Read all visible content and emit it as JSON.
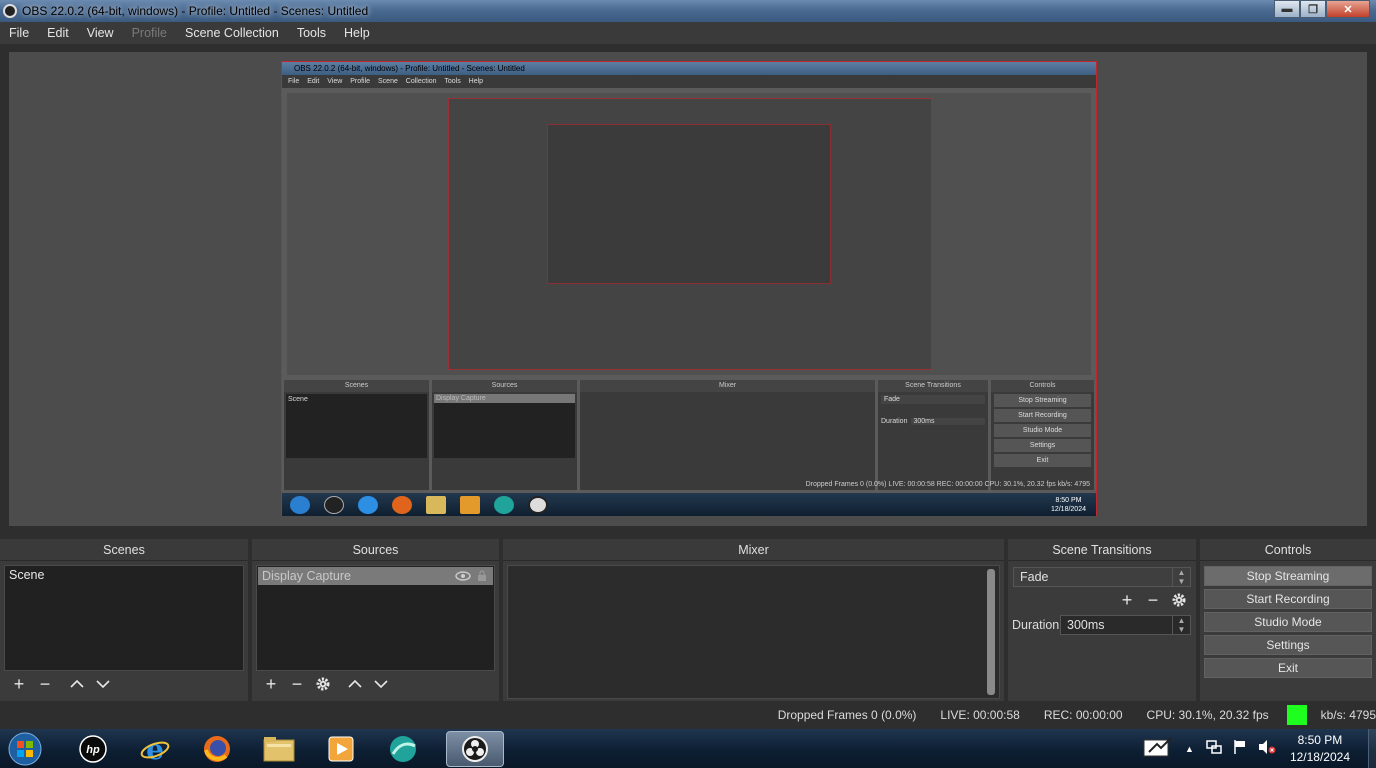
{
  "window": {
    "title": "OBS 22.0.2 (64-bit, windows) - Profile: Untitled - Scenes: Untitled",
    "minimize": "▬",
    "restore": "❐",
    "close": "✕"
  },
  "menu": [
    "File",
    "Edit",
    "View",
    "Profile",
    "Scene Collection",
    "Tools",
    "Help"
  ],
  "nested": {
    "title": "OBS 22.0.2 (64-bit, windows) - Profile: Untitled - Scenes: Untitled",
    "menu": "File Edit View Profile Scene Collection Tools Help",
    "docks": [
      "Scenes",
      "Sources",
      "Mixer",
      "Scene Transitions",
      "Controls"
    ],
    "scene": "Scene",
    "source": "Display Capture",
    "transition": "Fade",
    "duration_label": "Duration",
    "duration": "300ms",
    "controls": [
      "Stop Streaming",
      "Start Recording",
      "Studio Mode",
      "Settings",
      "Exit"
    ],
    "status": "Dropped Frames 0 (0.0%)     LIVE: 00:00:58     REC: 00:00:00     CPU: 30.1%, 20.32 fps          kb/s: 4795",
    "time": "8:50 PM",
    "date": "12/18/2024"
  },
  "docks": {
    "scenes": {
      "title": "Scenes",
      "items": [
        "Scene"
      ]
    },
    "sources": {
      "title": "Sources",
      "items": [
        "Display Capture"
      ]
    },
    "mixer": {
      "title": "Mixer"
    },
    "transitions": {
      "title": "Scene Transitions",
      "selected": "Fade",
      "duration_label": "Duration",
      "duration": "300ms"
    },
    "controls": {
      "title": "Controls",
      "stop_streaming": "Stop Streaming",
      "start_recording": "Start Recording",
      "studio_mode": "Studio Mode",
      "settings": "Settings",
      "exit": "Exit"
    }
  },
  "status": {
    "dropped": "Dropped Frames 0 (0.0%)",
    "live": "LIVE: 00:00:58",
    "rec": "REC: 00:00:00",
    "cpu": "CPU: 30.1%, 20.32 fps",
    "kbps": "kb/s: 4795",
    "indicator_color": "#1fff1f"
  },
  "taskbar": {
    "icons": [
      "start-icon",
      "hp-icon",
      "ie-icon",
      "firefox-icon",
      "folder-icon",
      "media-player-icon",
      "browser-icon",
      "obs-icon"
    ],
    "tray_up": "▲",
    "time": "8:50 PM",
    "date": "12/18/2024"
  }
}
